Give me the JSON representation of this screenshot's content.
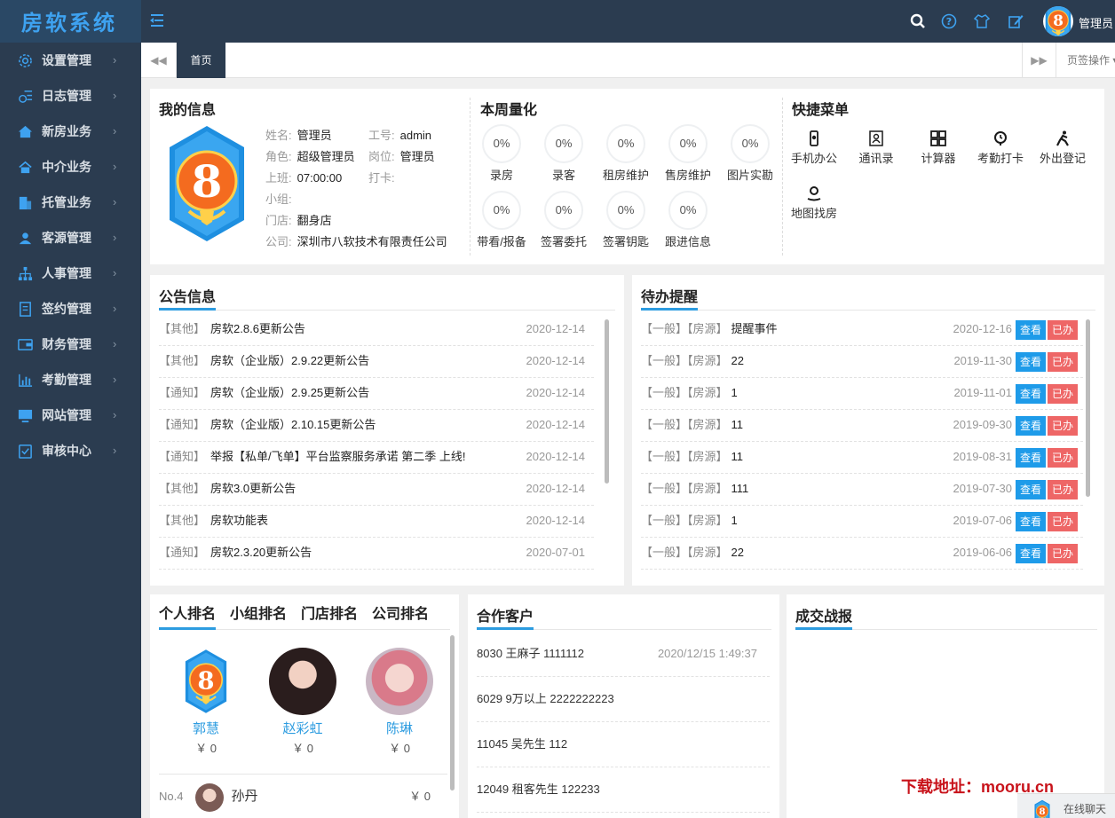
{
  "app": {
    "title": "房软系统"
  },
  "topbar": {
    "user_name": "管理员"
  },
  "sidebar": {
    "items": [
      {
        "label": "设置管理",
        "icon": "gear-icon"
      },
      {
        "label": "日志管理",
        "icon": "log-icon"
      },
      {
        "label": "新房业务",
        "icon": "house-icon"
      },
      {
        "label": "中介业务",
        "icon": "home-icon"
      },
      {
        "label": "托管业务",
        "icon": "building-icon"
      },
      {
        "label": "客源管理",
        "icon": "customers-icon"
      },
      {
        "label": "人事管理",
        "icon": "org-chart-icon"
      },
      {
        "label": "签约管理",
        "icon": "contract-icon"
      },
      {
        "label": "财务管理",
        "icon": "wallet-icon"
      },
      {
        "label": "考勤管理",
        "icon": "bar-chart-icon"
      },
      {
        "label": "网站管理",
        "icon": "monitor-icon"
      },
      {
        "label": "审核中心",
        "icon": "checklist-icon"
      }
    ]
  },
  "tabs": {
    "prev": "◀◀",
    "home": "首页",
    "next": "▶▶",
    "ops": "页签操作 ▾"
  },
  "my_info": {
    "title": "我的信息",
    "rows": [
      {
        "label": "姓名:",
        "value": "管理员",
        "label2": "工号:",
        "value2": "admin"
      },
      {
        "label": "角色:",
        "value": "超级管理员",
        "label2": "岗位:",
        "value2": "管理员"
      },
      {
        "label": "上班:",
        "value": "07:00:00",
        "label2": "打卡:",
        "value2": ""
      },
      {
        "label": "小组:",
        "value": ""
      },
      {
        "label": "门店:",
        "value": "翻身店"
      },
      {
        "label": "公司:",
        "value": "深圳市八软技术有限责任公司"
      }
    ]
  },
  "weekly": {
    "title": "本周量化",
    "items": [
      {
        "value": "0%",
        "label": "录房"
      },
      {
        "value": "0%",
        "label": "录客"
      },
      {
        "value": "0%",
        "label": "租房维护"
      },
      {
        "value": "0%",
        "label": "售房维护"
      },
      {
        "value": "0%",
        "label": "图片实勘"
      },
      {
        "value": "0%",
        "label": "带看/报备"
      },
      {
        "value": "0%",
        "label": "签署委托"
      },
      {
        "value": "0%",
        "label": "签署钥匙"
      },
      {
        "value": "0%",
        "label": "跟进信息"
      }
    ]
  },
  "quick_menu": {
    "title": "快捷菜单",
    "items": [
      {
        "label": "手机办公",
        "icon": "phone-icon"
      },
      {
        "label": "通讯录",
        "icon": "contacts-icon"
      },
      {
        "label": "计算器",
        "icon": "calculator-icon"
      },
      {
        "label": "考勤打卡",
        "icon": "clock-icon"
      },
      {
        "label": "外出登记",
        "icon": "walking-icon"
      },
      {
        "label": "地图找房",
        "icon": "map-pin-icon"
      }
    ]
  },
  "notices": {
    "title": "公告信息",
    "rows": [
      {
        "cat": "【其他】",
        "title": "房软2.8.6更新公告",
        "date": "2020-12-14"
      },
      {
        "cat": "【其他】",
        "title": "房软（企业版）2.9.22更新公告",
        "date": "2020-12-14"
      },
      {
        "cat": "【通知】",
        "title": "房软（企业版）2.9.25更新公告",
        "date": "2020-12-14"
      },
      {
        "cat": "【通知】",
        "title": "房软（企业版）2.10.15更新公告",
        "date": "2020-12-14"
      },
      {
        "cat": "【通知】",
        "title": "举报【私单/飞单】平台监察服务承诺 第二季 上线!",
        "date": "2020-12-14"
      },
      {
        "cat": "【其他】",
        "title": "房软3.0更新公告",
        "date": "2020-12-14"
      },
      {
        "cat": "【其他】",
        "title": "房软功能表",
        "date": "2020-12-14"
      },
      {
        "cat": "【通知】",
        "title": "房软2.3.20更新公告",
        "date": "2020-07-01"
      }
    ]
  },
  "todos": {
    "title": "待办提醒",
    "view_label": "查看",
    "done_label": "已办",
    "rows": [
      {
        "level": "【一般】",
        "type": "【房源】",
        "title": "提醒事件",
        "date": "2020-12-16"
      },
      {
        "level": "【一般】",
        "type": "【房源】",
        "title": "22",
        "date": "2019-11-30"
      },
      {
        "level": "【一般】",
        "type": "【房源】",
        "title": "1",
        "date": "2019-11-01"
      },
      {
        "level": "【一般】",
        "type": "【房源】",
        "title": "11",
        "date": "2019-09-30"
      },
      {
        "level": "【一般】",
        "type": "【房源】",
        "title": "11",
        "date": "2019-08-31"
      },
      {
        "level": "【一般】",
        "type": "【房源】",
        "title": "111",
        "date": "2019-07-30"
      },
      {
        "level": "【一般】",
        "type": "【房源】",
        "title": "1",
        "date": "2019-07-06"
      },
      {
        "level": "【一般】",
        "type": "【房源】",
        "title": "22",
        "date": "2019-06-06"
      }
    ]
  },
  "ranking": {
    "tabs": [
      "个人排名",
      "小组排名",
      "门店排名",
      "公司排名"
    ],
    "top": [
      {
        "name": "郭慧",
        "money": "￥ 0"
      },
      {
        "name": "赵彩虹",
        "money": "￥ 0"
      },
      {
        "name": "陈琳",
        "money": "￥ 0"
      }
    ],
    "rest": [
      {
        "no": "No.4",
        "name": "孙丹",
        "money": "￥ 0"
      }
    ]
  },
  "coop": {
    "title": "合作客户",
    "rows": [
      {
        "text": "8030 王麻子 1111112",
        "date": "2020/12/15 1:49:37"
      },
      {
        "text": "6029 9万以上 2222222223",
        "date": ""
      },
      {
        "text": "11045 吴先生 112",
        "date": ""
      },
      {
        "text": "12049 租客先生 122233",
        "date": ""
      }
    ]
  },
  "deals": {
    "title": "成交战报"
  },
  "footer": {
    "download": "下载地址：mooru.cn",
    "chat": "在线聊天"
  },
  "colors": {
    "accent": "#2d9ce0",
    "sidebar": "#2b3c50",
    "view_btn": "#1e9be9",
    "done_btn": "#ee6666"
  }
}
